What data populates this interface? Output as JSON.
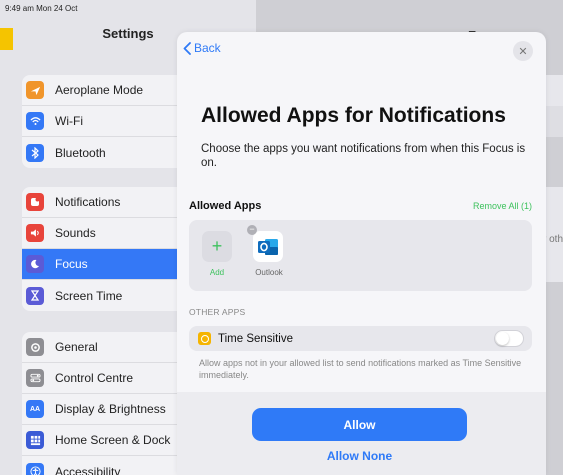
{
  "status_bar": {
    "time": "9:49 am  Mon 24 Oct"
  },
  "settings": {
    "title": "Settings",
    "groups": [
      [
        {
          "label": "Aeroplane Mode",
          "icon": "airplane-icon",
          "color": "#f0952b"
        },
        {
          "label": "Wi-Fi",
          "icon": "wifi-icon",
          "color": "#3478f6"
        },
        {
          "label": "Bluetooth",
          "icon": "bluetooth-icon",
          "color": "#3478f6"
        }
      ],
      [
        {
          "label": "Notifications",
          "icon": "notifications-icon",
          "color": "#e8443b"
        },
        {
          "label": "Sounds",
          "icon": "sounds-icon",
          "color": "#e8443b"
        },
        {
          "label": "Focus",
          "icon": "focus-icon",
          "color": "#5b5bd6",
          "active": true
        },
        {
          "label": "Screen Time",
          "icon": "screen-time-icon",
          "color": "#5b5bd6"
        }
      ],
      [
        {
          "label": "General",
          "icon": "gear-icon",
          "color": "#8e8e93"
        },
        {
          "label": "Control Centre",
          "icon": "control-centre-icon",
          "color": "#8e8e93"
        },
        {
          "label": "Display & Brightness",
          "icon": "display-icon",
          "color": "#3478f6"
        },
        {
          "label": "Home Screen & Dock",
          "icon": "home-screen-icon",
          "color": "#3b5bd6"
        },
        {
          "label": "Accessibility",
          "icon": "accessibility-icon",
          "color": "#3478f6"
        }
      ]
    ]
  },
  "detail": {
    "title": "Focus",
    "snippet": "r oth"
  },
  "sheet": {
    "back_label": "Back",
    "heading": "Allowed Apps for Notifications",
    "subtitle": "Choose the apps you want notifications from when this Focus is on.",
    "allowed_apps_label": "Allowed Apps",
    "remove_all_label": "Remove All (1)",
    "add_label": "Add",
    "allowed_apps": [
      {
        "name": "Outlook",
        "icon": "outlook-icon"
      }
    ],
    "other_apps_label": "OTHER APPS",
    "time_sensitive_label": "Time Sensitive",
    "time_sensitive_on": false,
    "time_sensitive_desc": "Allow apps not in your allowed list to send notifications marked as Time Sensitive immediately.",
    "allow_button": "Allow",
    "allow_none_button": "Allow None"
  },
  "colors": {
    "accent": "#2f7af7",
    "green": "#3ec25e"
  }
}
